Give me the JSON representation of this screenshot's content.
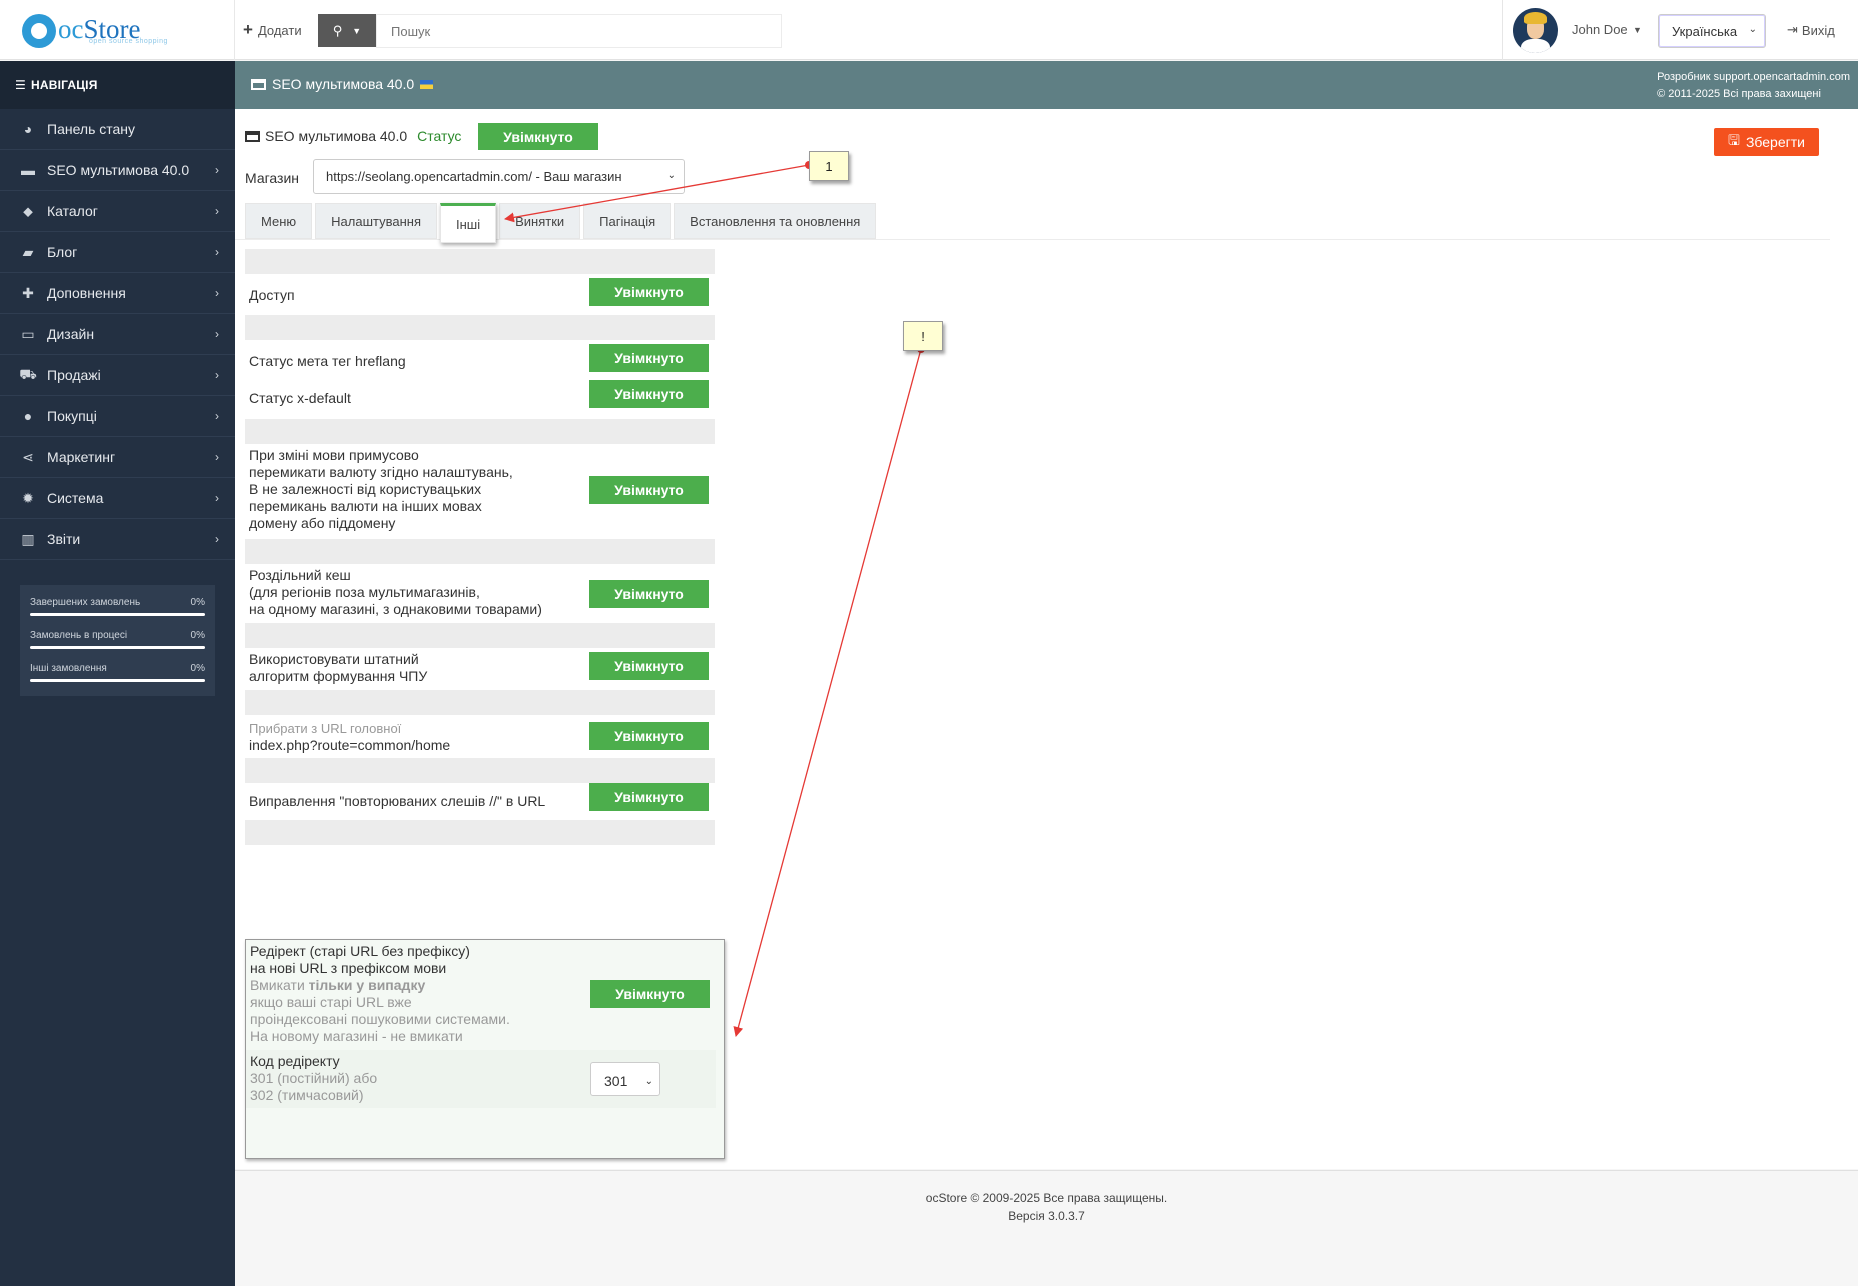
{
  "header": {
    "logo_oc": "oc",
    "logo_store": "Store",
    "logo_sub": "open source shopping",
    "add_label": "Додати",
    "search_placeholder": "Пошук",
    "user_name": "John Doe",
    "language": "Українська",
    "exit_label": "Вихід"
  },
  "sidebar": {
    "title": "НАВІГАЦІЯ",
    "items": [
      {
        "label": "Панель стану",
        "icon": "dashboard-icon",
        "glyph": "◕",
        "arrow": ""
      },
      {
        "label": "SEO мультимова 40.0",
        "icon": "card-icon",
        "glyph": "▬",
        "arrow": "›"
      },
      {
        "label": "Каталог",
        "icon": "tags-icon",
        "glyph": "⬥",
        "arrow": "›"
      },
      {
        "label": "Блог",
        "icon": "book-icon",
        "glyph": "▰",
        "arrow": "›"
      },
      {
        "label": "Доповнення",
        "icon": "puzzle-icon",
        "glyph": "✚",
        "arrow": "›"
      },
      {
        "label": "Дизайн",
        "icon": "monitor-icon",
        "glyph": "▭",
        "arrow": "›"
      },
      {
        "label": "Продажі",
        "icon": "cart-icon",
        "glyph": "⛟",
        "arrow": "›"
      },
      {
        "label": "Покупці",
        "icon": "user-icon",
        "glyph": "●",
        "arrow": "›"
      },
      {
        "label": "Маркетинг",
        "icon": "share-icon",
        "glyph": "⋖",
        "arrow": "›"
      },
      {
        "label": "Система",
        "icon": "gear-icon",
        "glyph": "✹",
        "arrow": "›"
      },
      {
        "label": "Звіти",
        "icon": "chart-icon",
        "glyph": "▥",
        "arrow": "›"
      }
    ],
    "stats": [
      {
        "label": "Завершених замовлень",
        "value": "0%",
        "progress": 0
      },
      {
        "label": "Замовлень в процесі",
        "value": "0%",
        "progress": 0
      },
      {
        "label": "Інші замовлення",
        "value": "0%",
        "progress": 0
      }
    ]
  },
  "page": {
    "title": "SEO мультимова 40.0",
    "developer_line1": "Розробник support.opencartadmin.com",
    "developer_line2": "© 2011-2025 Всі права захищені"
  },
  "module": {
    "title": "SEO мультимова 40.0",
    "status_label": "Статус",
    "status_value": "Увімкнуто",
    "save_label": "Зберегти",
    "store_label": "Магазин",
    "store_value": "https://seolang.opencartadmin.com/ - Ваш магазин"
  },
  "tabs": [
    "Меню",
    "Налаштування",
    "Інші",
    "Винятки",
    "Пагінація",
    "Встановлення та оновлення"
  ],
  "settings": {
    "button_label": "Увімкнуто",
    "access": "Доступ",
    "hreflang": "Статус мета тег hreflang",
    "xdefault": "Статус x-default",
    "currency_1": "При зміні мови примусово",
    "currency_2": "перемикати валюту згідно налаштувань,",
    "currency_3": "В не залежності від користувацьких",
    "currency_4": "перемикань валюти на інших мовах",
    "currency_5": "домену або піддомену",
    "cache_1": "Роздільний кеш",
    "cache_2": "(для регіонів поза мультимагазинів,",
    "cache_3": "на одному магазині, з однаковими товарами)",
    "seo_1": "Використовувати штатний",
    "seo_2": "алгоритм формування ЧПУ",
    "home_1": "Прибрати з URL головної",
    "home_2": "index.php?route=common/home",
    "slash": "Виправлення \"повторюваних слешів //\" в URL",
    "redirect_1": "Редірект (старі URL без префіксу)",
    "redirect_2": "на нові URL з префіксом мови",
    "redirect_3a": "Вмикати ",
    "redirect_3b": "тільки у випадку",
    "redirect_4": "якщо ваші старі URL вже",
    "redirect_5": "проіндексовані пошуковими системами.",
    "redirect_6": "На новому магазині - не вмикати",
    "code_1": "Код редіректу",
    "code_2": "301 (постійний) або",
    "code_3": "302 (тимчасовий)",
    "code_value": "301"
  },
  "footer": {
    "line1": "ocStore © 2009-2025 Все права защищены.",
    "line2": "Версія 3.0.3.7"
  },
  "annotations": {
    "note1": "1",
    "note2": "!",
    "color": "#e53935"
  }
}
